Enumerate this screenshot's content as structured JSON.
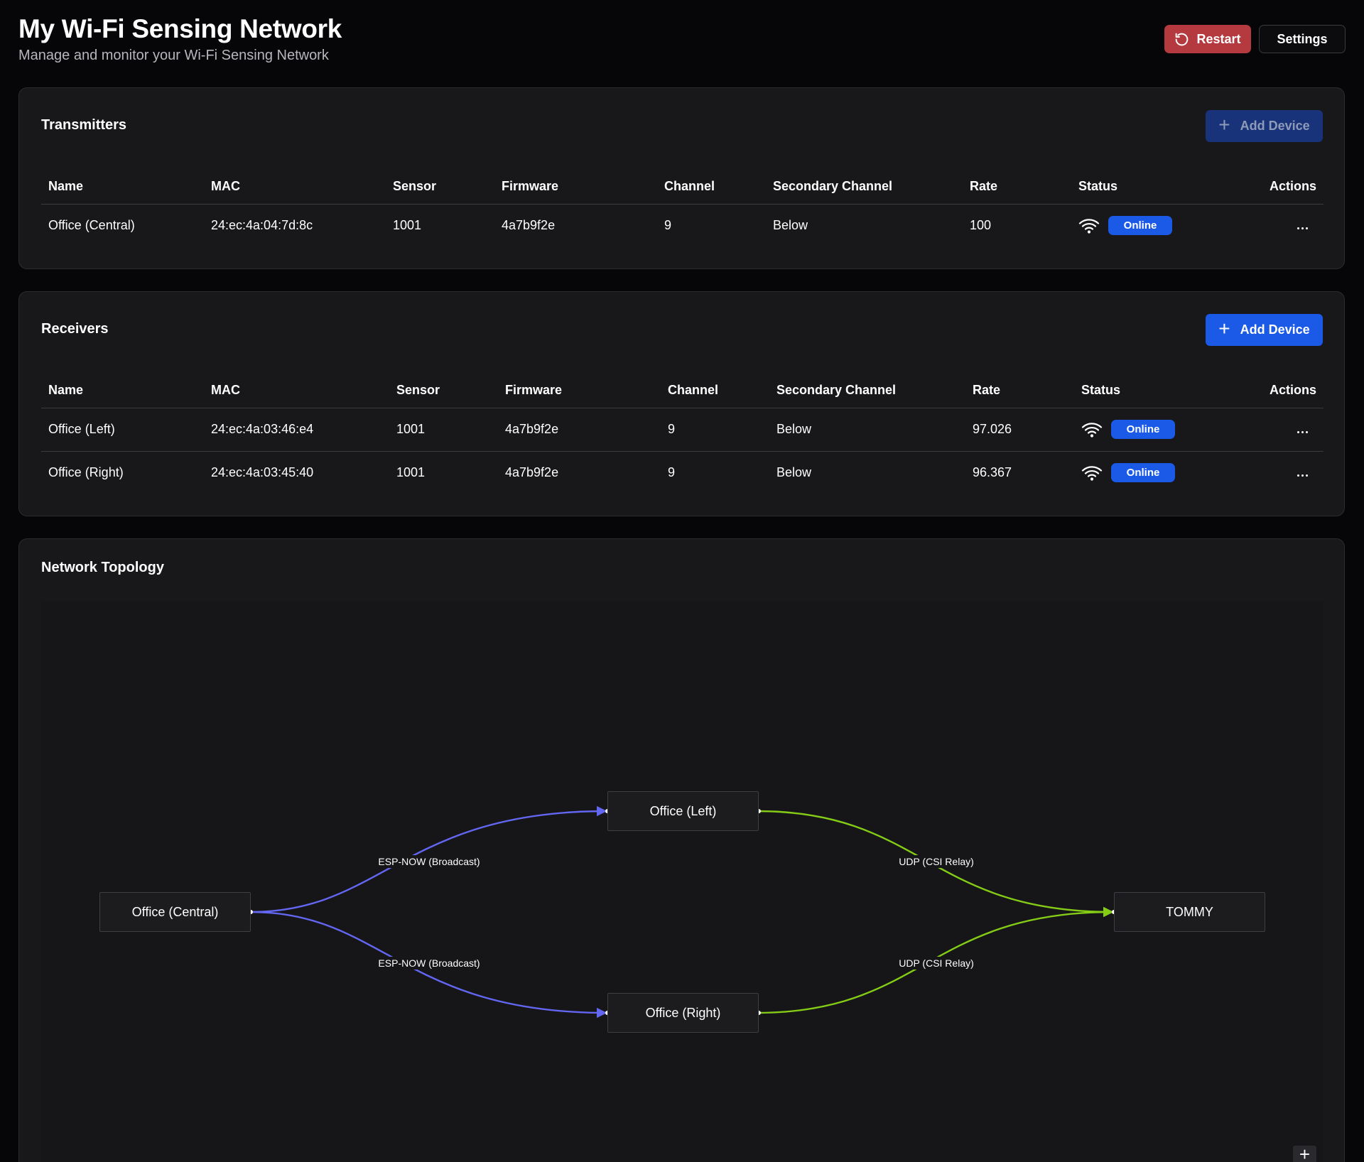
{
  "header": {
    "title": "My Wi-Fi Sensing Network",
    "subtitle": "Manage and monitor your Wi-Fi Sensing Network",
    "restart_label": "Restart",
    "settings_label": "Settings"
  },
  "transmitters": {
    "title": "Transmitters",
    "add_label": "Add Device",
    "columns": [
      "Name",
      "MAC",
      "Sensor",
      "Firmware",
      "Channel",
      "Secondary Channel",
      "Rate",
      "Status",
      "Actions"
    ],
    "rows": [
      {
        "name": "Office (Central)",
        "mac": "24:ec:4a:04:7d:8c",
        "sensor": "1001",
        "firmware": "4a7b9f2e",
        "channel": "9",
        "secondary": "Below",
        "rate": "100",
        "status": "Online"
      }
    ]
  },
  "receivers": {
    "title": "Receivers",
    "add_label": "Add Device",
    "columns": [
      "Name",
      "MAC",
      "Sensor",
      "Firmware",
      "Channel",
      "Secondary Channel",
      "Rate",
      "Status",
      "Actions"
    ],
    "rows": [
      {
        "name": "Office (Left)",
        "mac": "24:ec:4a:03:46:e4",
        "sensor": "1001",
        "firmware": "4a7b9f2e",
        "channel": "9",
        "secondary": "Below",
        "rate": "97.026",
        "status": "Online"
      },
      {
        "name": "Office (Right)",
        "mac": "24:ec:4a:03:45:40",
        "sensor": "1001",
        "firmware": "4a7b9f2e",
        "channel": "9",
        "secondary": "Below",
        "rate": "96.367",
        "status": "Online"
      }
    ]
  },
  "topology": {
    "title": "Network Topology",
    "nodes": {
      "central": "Office (Central)",
      "left": "Office (Left)",
      "right": "Office (Right)",
      "sink": "TOMMY"
    },
    "edge_labels": {
      "central_left": "ESP-NOW (Broadcast)",
      "central_right": "ESP-NOW (Broadcast)",
      "left_sink": "UDP (CSI Relay)",
      "right_sink": "UDP (CSI Relay)"
    },
    "zoom_label": "+"
  },
  "colors": {
    "accent": "#1a5ae6",
    "restart": "#b53a40",
    "espnow_edge": "#6366f1",
    "udp_edge": "#84cc16"
  }
}
